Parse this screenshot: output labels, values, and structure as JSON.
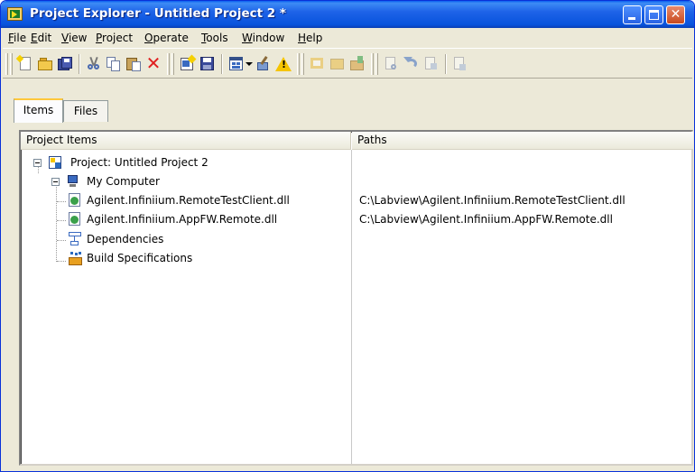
{
  "window": {
    "title": "Project Explorer - Untitled Project 2 *"
  },
  "menu": {
    "items": [
      {
        "label": "File",
        "key": "F",
        "rest": "ile"
      },
      {
        "label": "Edit",
        "key": "E",
        "rest": "dit"
      },
      {
        "label": "View",
        "key": "V",
        "rest": "iew"
      },
      {
        "label": "Project",
        "key": "P",
        "rest": "roject"
      },
      {
        "label": "Operate",
        "key": "O",
        "rest": "perate"
      },
      {
        "label": "Tools",
        "key": "T",
        "rest": "ools"
      },
      {
        "label": "Window",
        "key": "W",
        "rest": "indow"
      },
      {
        "label": "Help",
        "key": "H",
        "rest": "elp"
      }
    ]
  },
  "toolbar": {
    "icons": [
      "new-vi-icon",
      "open-icon",
      "save-all-icon",
      "cut-icon",
      "copy-icon",
      "paste-icon",
      "delete-icon",
      "add-file-icon",
      "save-icon",
      "vi-view-icon",
      "dropdown-arrow-icon",
      "properties-icon",
      "warning-icon",
      "build-icon",
      "deploy-icon",
      "project-props-icon",
      "find-icon",
      "undo-icon",
      "find-next-icon",
      "run-icon"
    ]
  },
  "tabs": [
    {
      "label": "Items",
      "active": true
    },
    {
      "label": "Files",
      "active": false
    }
  ],
  "columns": {
    "items": "Project Items",
    "paths": "Paths"
  },
  "tree": {
    "project": "Project: Untitled Project 2",
    "computer": "My Computer",
    "items": [
      {
        "name": "Agilent.Infiniium.RemoteTestClient.dll",
        "path": "C:\\Labview\\Agilent.Infiniium.RemoteTestClient.dll",
        "icon": "dll-icon"
      },
      {
        "name": "Agilent.Infiniium.AppFW.Remote.dll",
        "path": "C:\\Labview\\Agilent.Infiniium.AppFW.Remote.dll",
        "icon": "dll-icon"
      },
      {
        "name": "Dependencies",
        "path": "",
        "icon": "dependencies-icon"
      },
      {
        "name": "Build Specifications",
        "path": "",
        "icon": "build-specifications-icon"
      }
    ]
  },
  "colors": {
    "titlebar": "#0853dc",
    "window_bg": "#ece9d8",
    "tab_accent": "#ffc83c"
  }
}
